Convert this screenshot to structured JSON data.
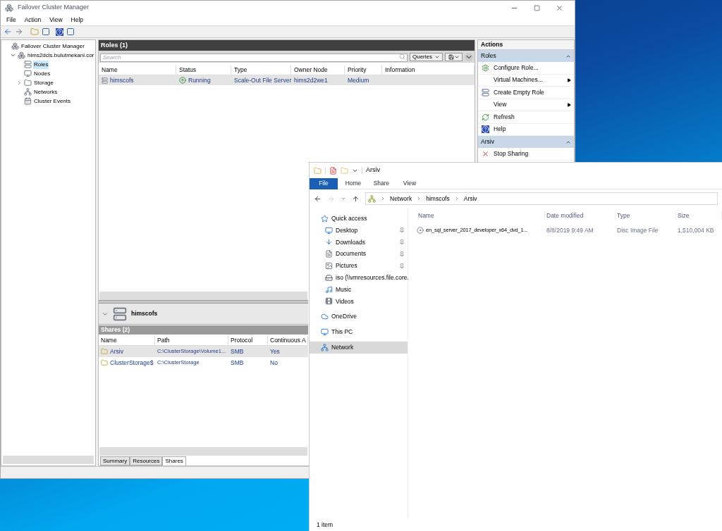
{
  "cluster_manager": {
    "title": "Failover Cluster Manager",
    "menu": [
      "File",
      "Action",
      "View",
      "Help"
    ],
    "tree": [
      {
        "label": "Failover Cluster Manager",
        "kind": "root",
        "selected": false,
        "children": [
          {
            "label": "hims2dcls.bulutmekani.cor",
            "kind": "cluster",
            "expanded": true,
            "selected": false,
            "children": [
              {
                "label": "Roles",
                "kind": "roles",
                "selected": true
              },
              {
                "label": "Nodes",
                "kind": "nodes",
                "selected": false
              },
              {
                "label": "Storage",
                "kind": "storage",
                "selected": false,
                "expanded": false
              },
              {
                "label": "Networks",
                "kind": "networks",
                "selected": false
              },
              {
                "label": "Cluster Events",
                "kind": "events",
                "selected": false
              }
            ]
          }
        ]
      }
    ],
    "roles": {
      "title": "Roles (1)",
      "search": {
        "placeholder": "Search"
      },
      "queries_button": "Queries",
      "columns": [
        "Name",
        "Status",
        "Type",
        "Owner Node",
        "Priority",
        "Information"
      ],
      "rows": [
        {
          "name": "himscofs",
          "status": "Running",
          "type": "Scale-Out File Server",
          "owner_node": "hims2d2we1",
          "priority": "Medium",
          "selected": true
        }
      ]
    },
    "detail": {
      "title": "himscofs",
      "section": "Shares (2)",
      "columns": [
        "Name",
        "Path",
        "Protocol",
        "Continuous A"
      ],
      "rows": [
        {
          "name": "Arsiv",
          "path": "C:\\ClusterStorage\\Volume1...",
          "protocol": "SMB",
          "continuous": "Yes",
          "selected": true
        },
        {
          "name": "ClusterStorage$",
          "path": "C:\\ClusterStorage",
          "protocol": "SMB",
          "continuous": "No",
          "selected": false
        }
      ],
      "tabs": [
        {
          "label": "Summary",
          "selected": false
        },
        {
          "label": "Resources",
          "selected": false
        },
        {
          "label": "Shares",
          "selected": true
        }
      ]
    },
    "actions": {
      "title": "Actions",
      "groups": [
        {
          "title": "Roles",
          "items": [
            {
              "label": "Configure Role...",
              "kind": "configure",
              "submenu": false
            },
            {
              "label": "Virtual Machines...",
              "kind": "none",
              "submenu": true
            },
            {
              "label": "Create Empty Role",
              "kind": "create",
              "submenu": false
            },
            {
              "label": "View",
              "kind": "none",
              "submenu": true
            },
            {
              "label": "Refresh",
              "kind": "refresh",
              "submenu": false
            },
            {
              "label": "Help",
              "kind": "help",
              "submenu": false
            }
          ]
        },
        {
          "title": "Arsiv",
          "items": [
            {
              "label": "Stop Sharing",
              "kind": "stop",
              "submenu": false
            }
          ]
        }
      ]
    }
  },
  "explorer": {
    "title": "Arsiv",
    "ribbon_tabs": [
      {
        "label": "File",
        "kind": "file"
      },
      {
        "label": "Home",
        "kind": "tab"
      },
      {
        "label": "Share",
        "kind": "tab"
      },
      {
        "label": "View",
        "kind": "tab"
      }
    ],
    "breadcrumb": [
      "Network",
      "himscofs",
      "Arsiv"
    ],
    "nav": [
      {
        "label": "Quick access",
        "kind": "star",
        "pinned": false,
        "selected": false,
        "group": true
      },
      {
        "label": "Desktop",
        "kind": "desktop",
        "pinned": true,
        "selected": false,
        "group": false
      },
      {
        "label": "Downloads",
        "kind": "downloads",
        "pinned": true,
        "selected": false,
        "group": false
      },
      {
        "label": "Documents",
        "kind": "documents",
        "pinned": true,
        "selected": false,
        "group": false
      },
      {
        "label": "Pictures",
        "kind": "pictures",
        "pinned": true,
        "selected": false,
        "group": false
      },
      {
        "label": "iso (\\\\vmresources.file.core.",
        "kind": "drive",
        "pinned": false,
        "selected": false,
        "group": false
      },
      {
        "label": "Music",
        "kind": "music",
        "pinned": false,
        "selected": false,
        "group": false
      },
      {
        "label": "Videos",
        "kind": "videos",
        "pinned": false,
        "selected": false,
        "group": false
      },
      {
        "label": "OneDrive",
        "kind": "cloud",
        "pinned": false,
        "selected": false,
        "group": true
      },
      {
        "label": "This PC",
        "kind": "pc",
        "pinned": false,
        "selected": false,
        "group": true
      },
      {
        "label": "Network",
        "kind": "network",
        "pinned": false,
        "selected": true,
        "group": true
      }
    ],
    "columns": [
      "Name",
      "Date modified",
      "Type",
      "Size"
    ],
    "files": [
      {
        "name": "en_sql_server_2017_developer_x64_dvd_1...",
        "date": "8/8/2019 9:49 AM",
        "type": "Disc Image File",
        "size": "1,510,004 KB"
      }
    ],
    "status": "1 item"
  }
}
